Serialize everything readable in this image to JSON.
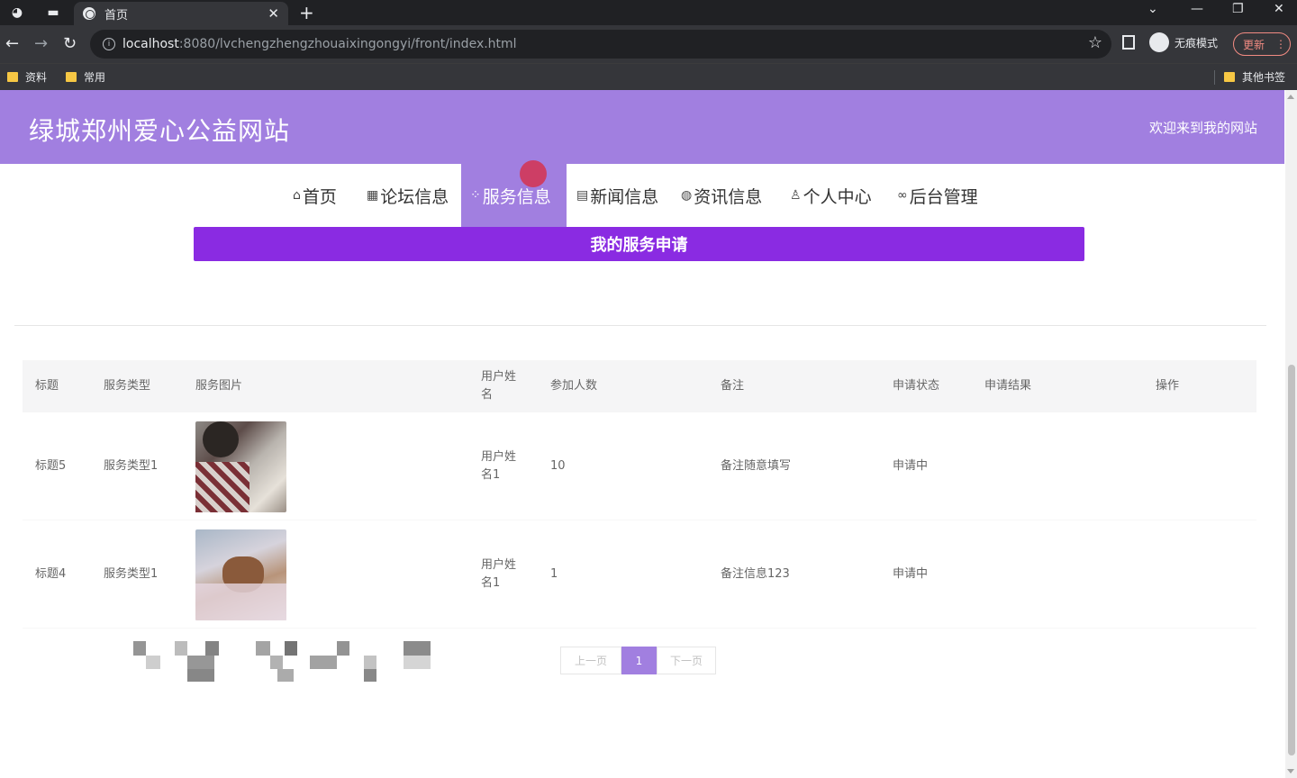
{
  "browser": {
    "tab_title": "首页",
    "url_host": "localhost",
    "url_rest": ":8080/lvchengzhengzhouaixingongyi/front/index.html",
    "incognito_label": "无痕模式",
    "update_label": "更新",
    "bookmarks": [
      "资料",
      "常用"
    ],
    "other_bookmarks": "其他书签"
  },
  "site": {
    "title": "绿城郑州爱心公益网站",
    "welcome": "欢迎来到我的网站"
  },
  "nav": [
    {
      "label": "首页",
      "icon": "home-icon"
    },
    {
      "label": "论坛信息",
      "icon": "forum-icon"
    },
    {
      "label": "服务信息",
      "icon": "grid-icon",
      "active": true
    },
    {
      "label": "新闻信息",
      "icon": "news-icon"
    },
    {
      "label": "资讯信息",
      "icon": "globe-icon"
    },
    {
      "label": "个人中心",
      "icon": "user-icon"
    },
    {
      "label": "后台管理",
      "icon": "link-icon"
    }
  ],
  "banner": "我的服务申请",
  "table": {
    "headers": [
      "标题",
      "服务类型",
      "服务图片",
      "用户姓名",
      "参加人数",
      "备注",
      "申请状态",
      "申请结果",
      "操作"
    ],
    "rows": [
      {
        "title": "标题5",
        "type": "服务类型1",
        "user": "用户姓名1",
        "count": "10",
        "note": "备注随意填写",
        "status": "申请中",
        "result": ""
      },
      {
        "title": "标题4",
        "type": "服务类型1",
        "user": "用户姓名1",
        "count": "1",
        "note": "备注信息123",
        "status": "申请中",
        "result": ""
      }
    ]
  },
  "pager": {
    "prev": "上一页",
    "current": "1",
    "next": "下一页"
  }
}
